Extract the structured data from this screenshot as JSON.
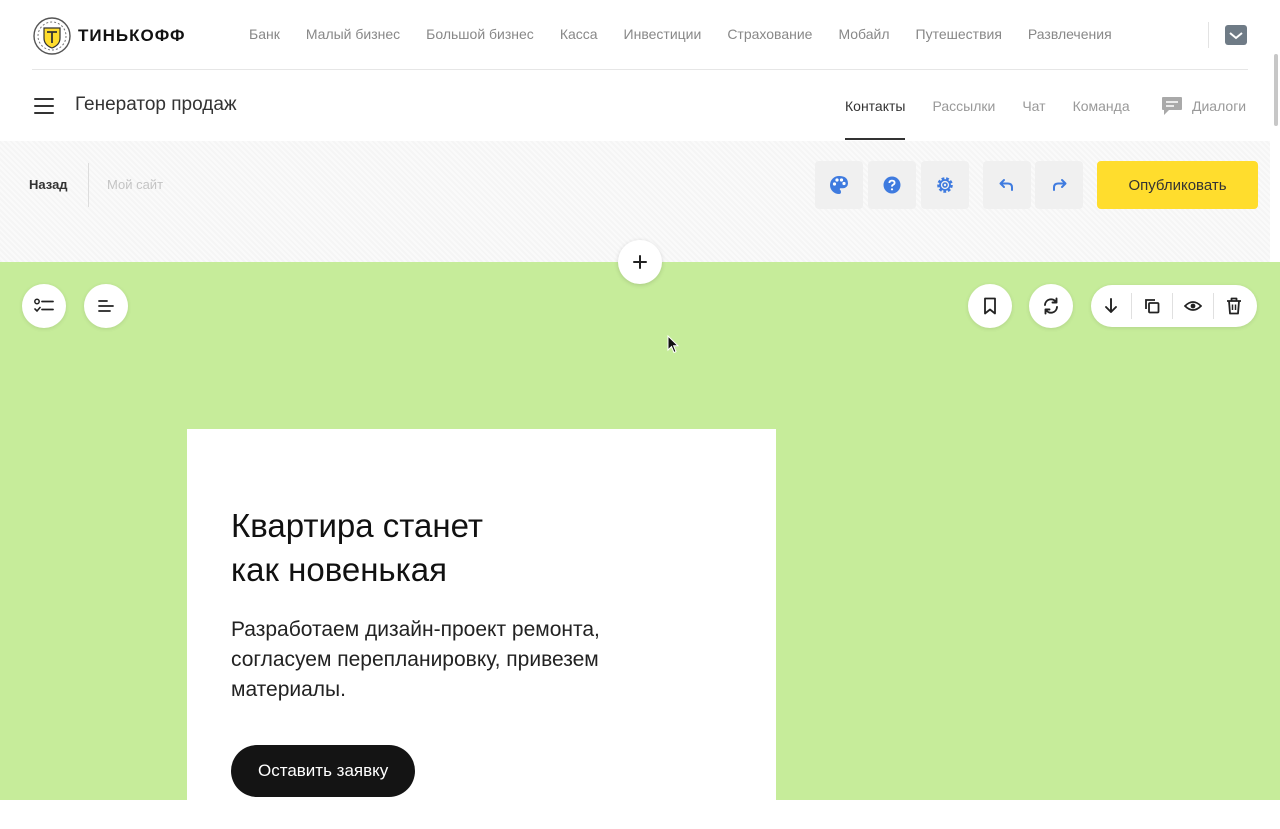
{
  "brand": {
    "name": "ТИНЬКОФФ"
  },
  "bank_nav": [
    {
      "label": "Банк"
    },
    {
      "label": "Малый бизнес"
    },
    {
      "label": "Большой бизнес"
    },
    {
      "label": "Касса"
    },
    {
      "label": "Инвестиции"
    },
    {
      "label": "Страхование"
    },
    {
      "label": "Мобайл"
    },
    {
      "label": "Путешествия"
    },
    {
      "label": "Развлечения"
    }
  ],
  "product": {
    "title": "Генератор продаж",
    "tabs": [
      {
        "label": "Контакты",
        "active": true
      },
      {
        "label": "Рассылки",
        "active": false
      },
      {
        "label": "Чат",
        "active": false
      },
      {
        "label": "Команда",
        "active": false
      }
    ],
    "dialogs_label": "Диалоги"
  },
  "editor": {
    "back_label": "Назад",
    "site_name": "Мой сайт",
    "tools": [
      "palette-icon",
      "help-icon",
      "settings-icon",
      "undo-icon",
      "redo-icon"
    ],
    "publish_label": "Опубликовать"
  },
  "block": {
    "background": "#c6ec9a",
    "headline_line1": "Квартира станет",
    "headline_line2": "как новенькая",
    "description": "Разработаем дизайн-проект ремонта, согласуем перепланировку, привезем материалы.",
    "cta_label": "Оставить заявку"
  },
  "colors": {
    "accent_yellow": "#ffdd2d",
    "tool_blue": "#3f7bdf",
    "cta_dark": "#141414"
  }
}
